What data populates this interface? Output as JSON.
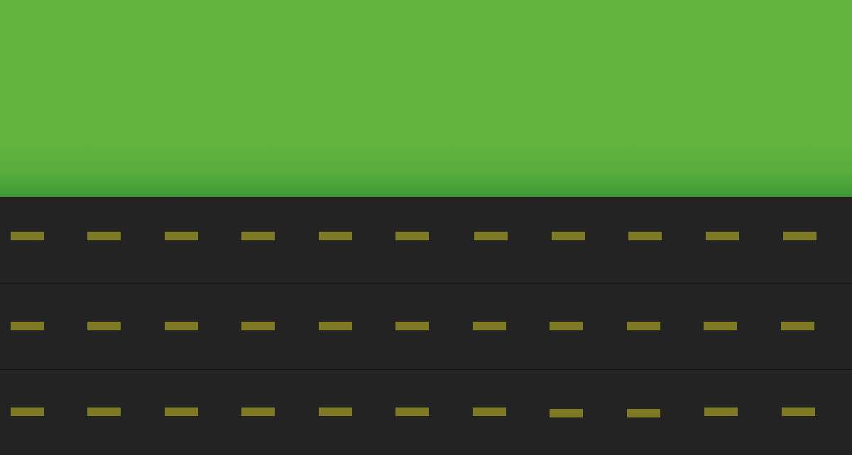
{
  "scene": {
    "grass_color": "#62b43e",
    "grass_edge_color": "#3f9a37",
    "road_color": "#232323",
    "lane_divider_color": "#111111",
    "dash_color": "#7e7a24",
    "lane_count": 3,
    "dashes_per_lane": 11
  }
}
